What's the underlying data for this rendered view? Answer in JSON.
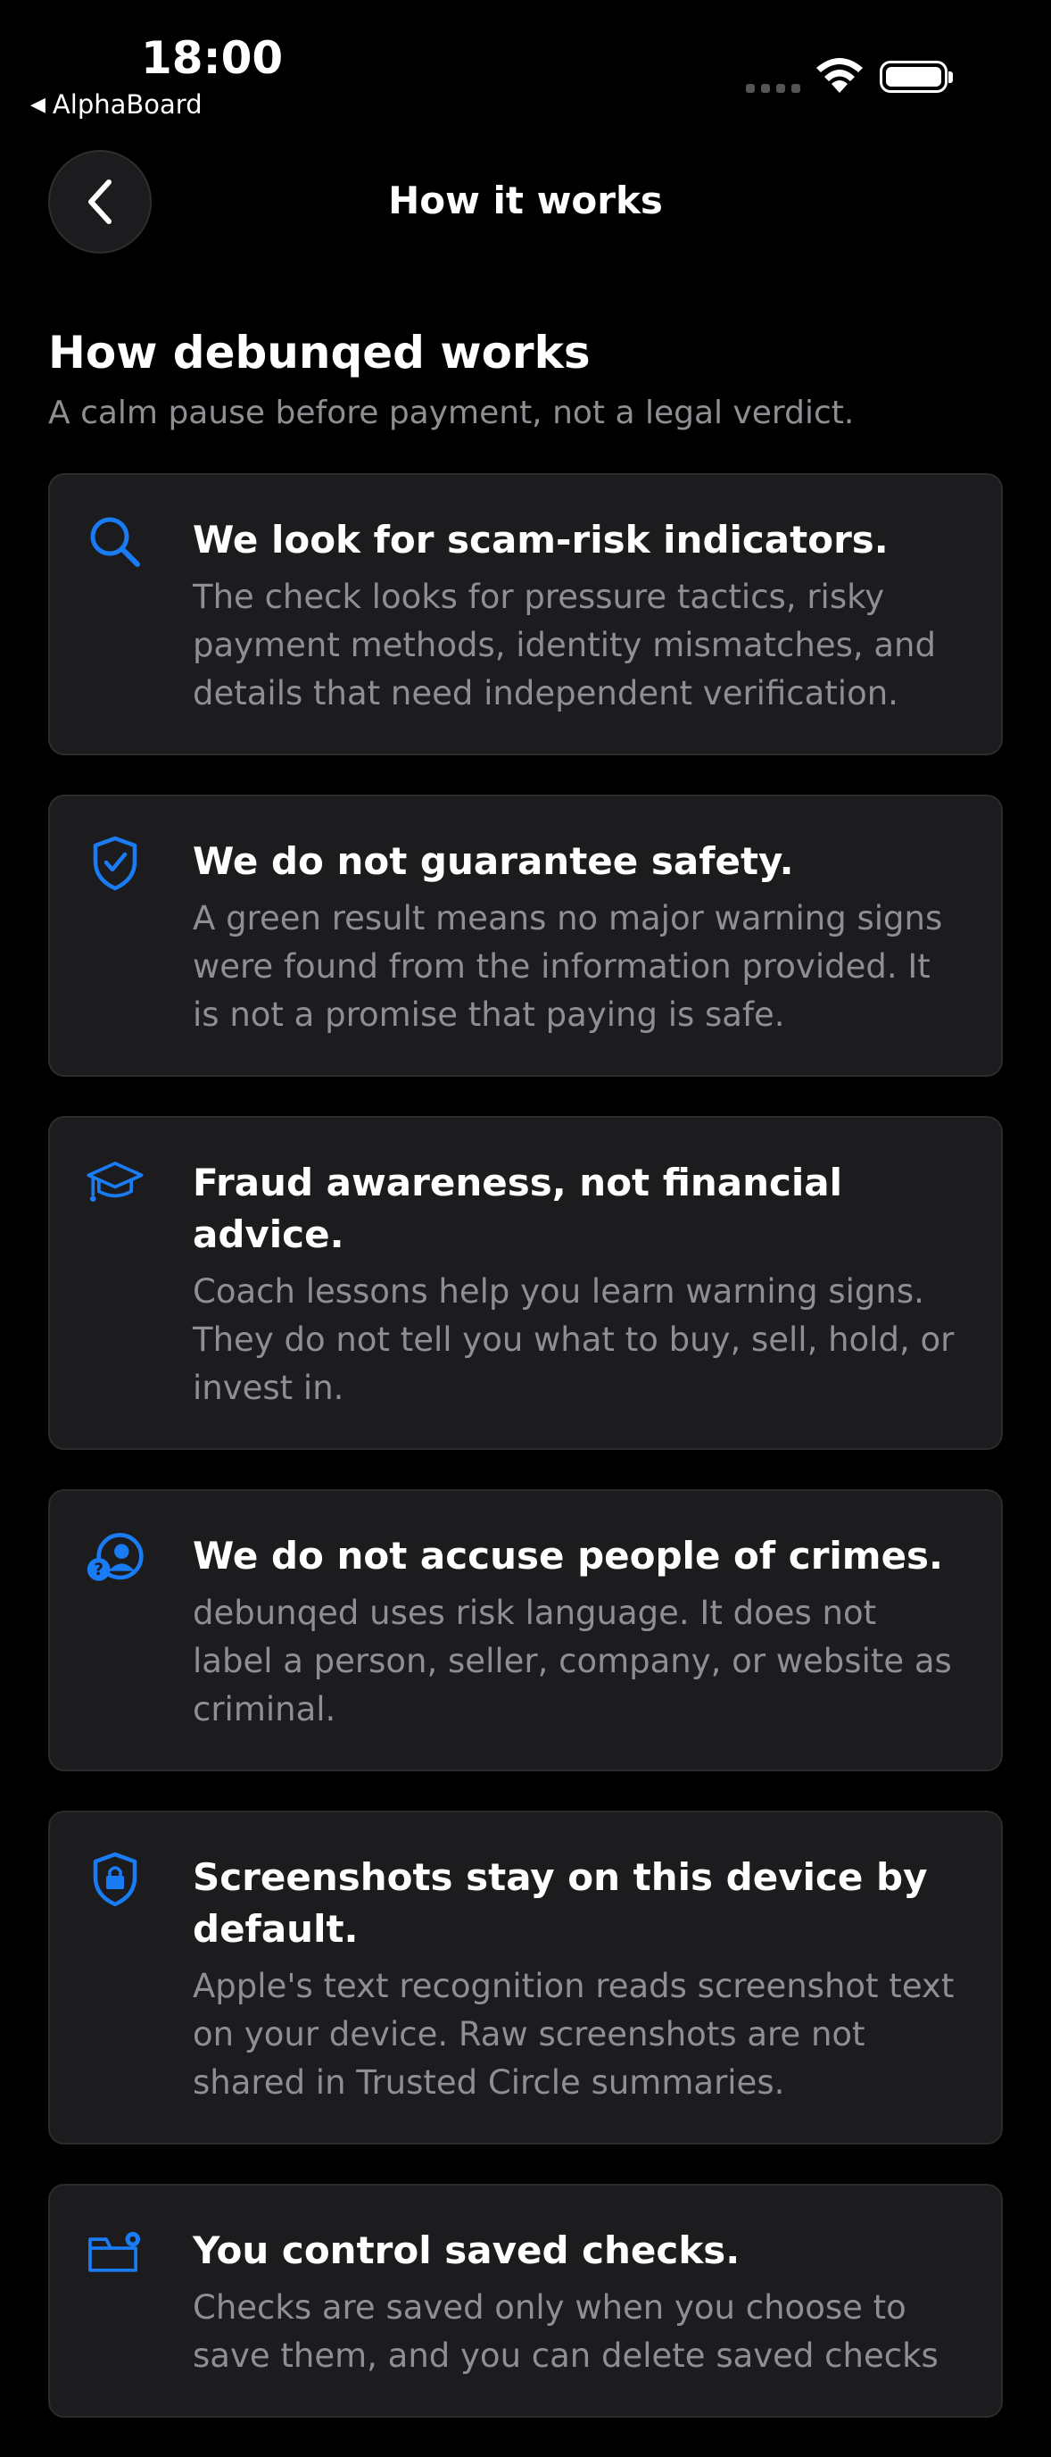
{
  "status_bar": {
    "time": "18:00",
    "back_app_label": "AlphaBoard"
  },
  "nav": {
    "title": "How it works",
    "back_icon": "chevron-left-icon"
  },
  "header": {
    "title": "How debunqed works",
    "subtitle": "A calm pause before payment, not a legal verdict."
  },
  "accent_color": "#1a7cf5",
  "cards": [
    {
      "icon": "search-icon",
      "title": "We look for scam-risk indicators.",
      "body": "The check looks for pressure tactics, risky payment methods, identity mismatches, and details that need independent verification."
    },
    {
      "icon": "shield-check-icon",
      "title": "We do not guarantee safety.",
      "body": "A green result means no major warning signs were found from the information provided. It is not a promise that paying is safe."
    },
    {
      "icon": "graduation-cap-icon",
      "title": "Fraud awareness, not financial advice.",
      "body": "Coach lessons help you learn warning signs. They do not tell you what to buy, sell, hold, or invest in."
    },
    {
      "icon": "person-question-icon",
      "title": "We do not accuse people of crimes.",
      "body": "debunqed uses risk language. It does not label a person, seller, company, or website as criminal."
    },
    {
      "icon": "lock-shield-icon",
      "title": "Screenshots stay on this device by default.",
      "body": "Apple's text recognition reads screenshot text on your device. Raw screenshots are not shared in Trusted Circle summaries."
    },
    {
      "icon": "folder-gear-icon",
      "title": "You control saved checks.",
      "body": "Checks are saved only when you choose to save them, and you can delete saved checks"
    }
  ]
}
